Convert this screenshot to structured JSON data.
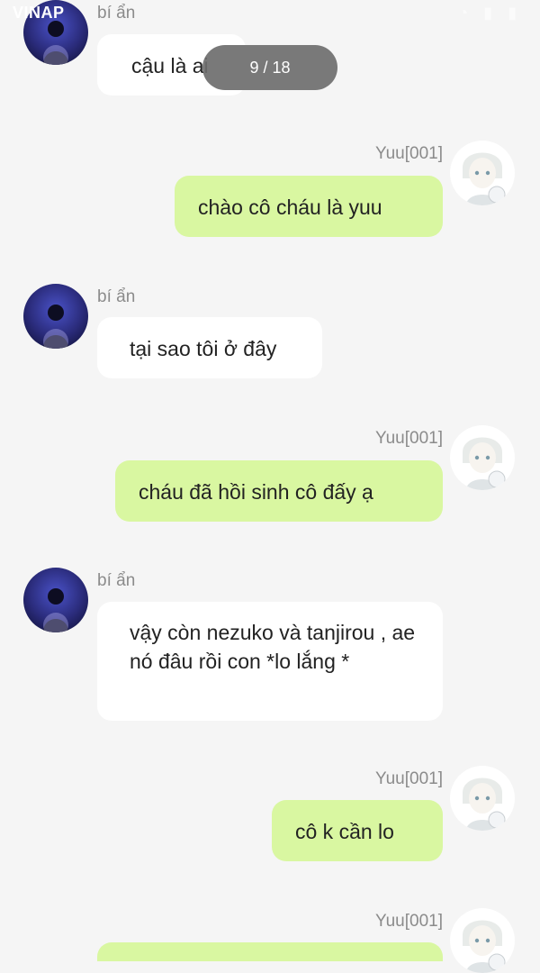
{
  "status_bar": {
    "carrier": "VINAP"
  },
  "page_indicator": "9 / 18",
  "messages": [
    {
      "side": "left",
      "sender": "bí ẩn",
      "text": "cậu là ai"
    },
    {
      "side": "right",
      "sender": "Yuu[001]",
      "text": "chào cô cháu là yuu"
    },
    {
      "side": "left",
      "sender": "bí ẩn",
      "text": "tại sao tôi ở đây"
    },
    {
      "side": "right",
      "sender": "Yuu[001]",
      "text": "cháu đã hồi sinh cô đấy ạ"
    },
    {
      "side": "left",
      "sender": "bí ẩn",
      "text": "vậy còn nezuko và tanjirou , ae nó đâu rồi con *lo lắng *"
    },
    {
      "side": "right",
      "sender": "Yuu[001]",
      "text": "cô k cần lo"
    },
    {
      "side": "right",
      "sender": "Yuu[001]",
      "text": ""
    }
  ],
  "colors": {
    "background": "#f5f5f5",
    "left_bubble": "#ffffff",
    "right_bubble": "#d9f7a1",
    "sender_name": "#8b8b8b"
  },
  "icons": {
    "left_avatar": "night-sky-silhouette-avatar",
    "right_avatar": "anime-boy-avatar"
  }
}
